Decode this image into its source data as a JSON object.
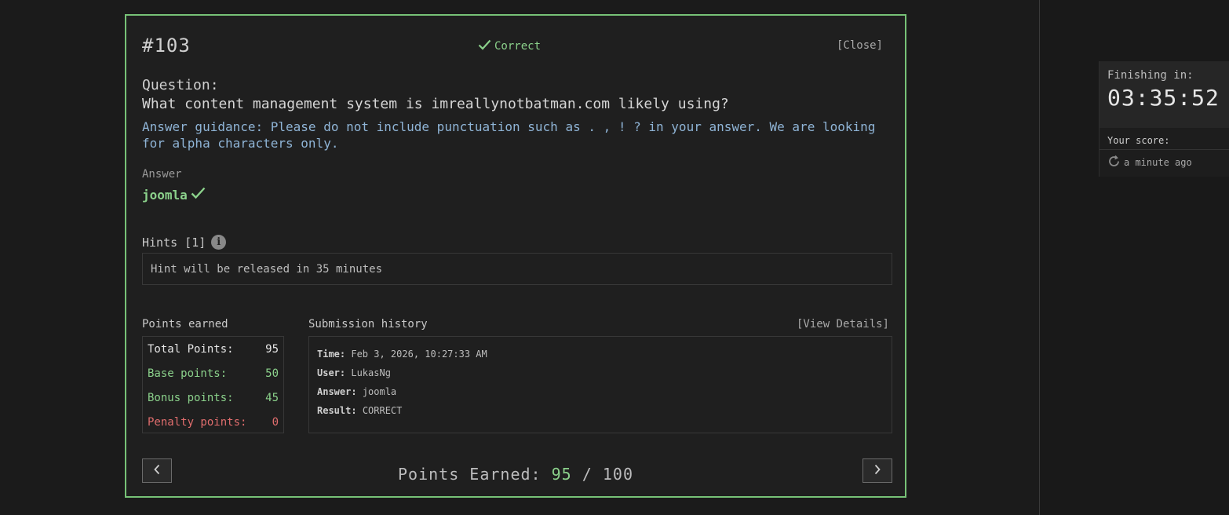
{
  "question": {
    "number": "#103",
    "status": "Correct",
    "close_label": "[Close]",
    "label": "Question:",
    "text": "What content management system is imreallynotbatman.com likely using?",
    "guidance": "Answer guidance: Please do not include punctuation such as . , ! ? in your answer. We are looking for alpha characters only."
  },
  "answer": {
    "label": "Answer",
    "value": "joomla"
  },
  "hints": {
    "label": "Hints [1]",
    "message": "Hint will be released in 35 minutes"
  },
  "points": {
    "label": "Points earned",
    "rows": [
      {
        "label": "Total Points:",
        "value": "95"
      },
      {
        "label": "Base points:",
        "value": "50"
      },
      {
        "label": "Bonus points:",
        "value": "45"
      },
      {
        "label": "Penalty points:",
        "value": "0"
      }
    ]
  },
  "submission": {
    "label": "Submission history",
    "view_label": "[View Details]",
    "rows": [
      {
        "key": "Time:",
        "value": "Feb 3, 2026, 10:27:33 AM"
      },
      {
        "key": "User:",
        "value": "LukasNg"
      },
      {
        "key": "Answer:",
        "value": "joomla"
      },
      {
        "key": "Result:",
        "value": "CORRECT"
      }
    ]
  },
  "footer": {
    "label": "Points Earned:",
    "earned": "95",
    "separator": "/",
    "total": "100"
  },
  "timer": {
    "label": "Finishing in:",
    "value": "03:35:52",
    "score_label": "Your score:",
    "score_updated": "a minute ago"
  },
  "colors": {
    "accent_green": "#8bd18b",
    "border_green": "#77c277",
    "penalty_red": "#e06d6d",
    "guidance_blue": "#8fb4d6"
  }
}
